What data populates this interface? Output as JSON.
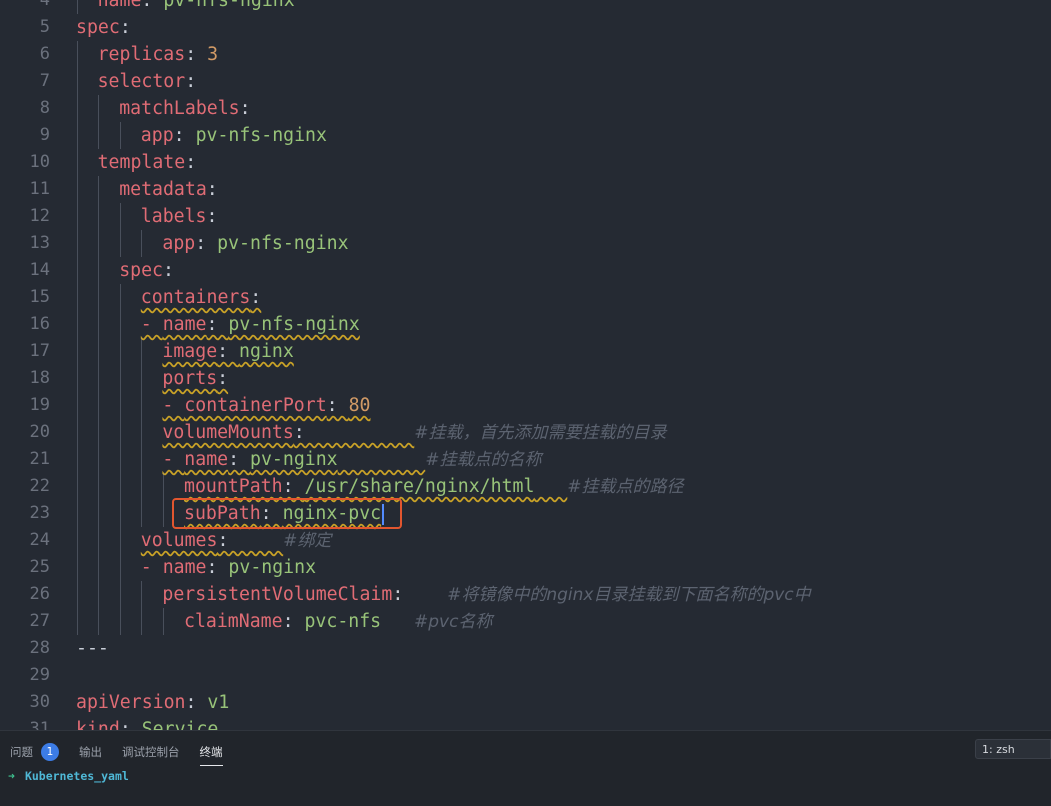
{
  "editor": {
    "lines": [
      {
        "n": "4",
        "guides": [
          1
        ],
        "tokens": [
          {
            "t": "name",
            "c": "key"
          },
          {
            "t": ": ",
            "c": "punc"
          },
          {
            "t": "pv-nfs-nginx",
            "c": "str"
          }
        ]
      },
      {
        "n": "5",
        "guides": [],
        "tokens": [
          {
            "t": "spec",
            "c": "key"
          },
          {
            "t": ":",
            "c": "punc"
          }
        ]
      },
      {
        "n": "6",
        "guides": [
          1
        ],
        "tokens": [
          {
            "t": "replicas",
            "c": "key"
          },
          {
            "t": ": ",
            "c": "punc"
          },
          {
            "t": "3",
            "c": "num"
          }
        ]
      },
      {
        "n": "7",
        "guides": [
          1
        ],
        "tokens": [
          {
            "t": "selector",
            "c": "key"
          },
          {
            "t": ":",
            "c": "punc"
          }
        ]
      },
      {
        "n": "8",
        "guides": [
          1,
          2
        ],
        "tokens": [
          {
            "t": "matchLabels",
            "c": "key"
          },
          {
            "t": ":",
            "c": "punc"
          }
        ]
      },
      {
        "n": "9",
        "guides": [
          1,
          2,
          3
        ],
        "tokens": [
          {
            "t": "app",
            "c": "key"
          },
          {
            "t": ": ",
            "c": "punc"
          },
          {
            "t": "pv-nfs-nginx",
            "c": "str"
          }
        ]
      },
      {
        "n": "10",
        "guides": [
          1
        ],
        "tokens": [
          {
            "t": "template",
            "c": "key"
          },
          {
            "t": ":",
            "c": "punc"
          }
        ]
      },
      {
        "n": "11",
        "guides": [
          1,
          2
        ],
        "tokens": [
          {
            "t": "metadata",
            "c": "key"
          },
          {
            "t": ":",
            "c": "punc"
          }
        ]
      },
      {
        "n": "12",
        "guides": [
          1,
          2,
          3
        ],
        "tokens": [
          {
            "t": "labels",
            "c": "key"
          },
          {
            "t": ":",
            "c": "punc"
          }
        ]
      },
      {
        "n": "13",
        "guides": [
          1,
          2,
          3,
          4
        ],
        "tokens": [
          {
            "t": "app",
            "c": "key"
          },
          {
            "t": ": ",
            "c": "punc"
          },
          {
            "t": "pv-nfs-nginx",
            "c": "str"
          }
        ]
      },
      {
        "n": "14",
        "guides": [
          1,
          2
        ],
        "tokens": [
          {
            "t": "spec",
            "c": "key"
          },
          {
            "t": ":",
            "c": "punc"
          }
        ]
      },
      {
        "n": "15",
        "guides": [
          1,
          2,
          3
        ],
        "wavy": true,
        "tokens": [
          {
            "t": "containers",
            "c": "key"
          },
          {
            "t": ":",
            "c": "punc"
          }
        ]
      },
      {
        "n": "16",
        "guides": [
          1,
          2,
          3
        ],
        "wavy": true,
        "tokens": [
          {
            "t": "- ",
            "c": "key"
          },
          {
            "t": "name",
            "c": "key"
          },
          {
            "t": ": ",
            "c": "punc"
          },
          {
            "t": "pv-nfs-nginx",
            "c": "str"
          }
        ]
      },
      {
        "n": "17",
        "guides": [
          1,
          2,
          3,
          4
        ],
        "wavy": true,
        "tokens": [
          {
            "t": "image",
            "c": "key"
          },
          {
            "t": ": ",
            "c": "punc"
          },
          {
            "t": "nginx",
            "c": "str"
          }
        ]
      },
      {
        "n": "18",
        "guides": [
          1,
          2,
          3,
          4
        ],
        "wavy": true,
        "tokens": [
          {
            "t": "ports",
            "c": "key"
          },
          {
            "t": ":",
            "c": "punc"
          }
        ]
      },
      {
        "n": "19",
        "guides": [
          1,
          2,
          3,
          4
        ],
        "wavy": true,
        "tokens": [
          {
            "t": "- ",
            "c": "key"
          },
          {
            "t": "containerPort",
            "c": "key"
          },
          {
            "t": ": ",
            "c": "punc"
          },
          {
            "t": "80",
            "c": "num"
          }
        ]
      },
      {
        "n": "20",
        "guides": [
          1,
          2,
          3,
          4
        ],
        "wavy": true,
        "tokens": [
          {
            "t": "volumeMounts",
            "c": "key"
          },
          {
            "t": ":          ",
            "c": "punc"
          },
          {
            "t": "#挂载，首先添加需要挂载的目录",
            "c": "cmt"
          }
        ]
      },
      {
        "n": "21",
        "guides": [
          1,
          2,
          3,
          4
        ],
        "wavy": true,
        "tokens": [
          {
            "t": "- ",
            "c": "key"
          },
          {
            "t": "name",
            "c": "key"
          },
          {
            "t": ": ",
            "c": "punc"
          },
          {
            "t": "pv-nginx",
            "c": "str"
          },
          {
            "t": "        ",
            "c": "punc"
          },
          {
            "t": "#挂载点的名称",
            "c": "cmt"
          }
        ]
      },
      {
        "n": "22",
        "guides": [
          1,
          2,
          3,
          4,
          5
        ],
        "wavy": true,
        "tokens": [
          {
            "t": "mountPath",
            "c": "key"
          },
          {
            "t": ": ",
            "c": "punc"
          },
          {
            "t": "/usr/share/nginx/html",
            "c": "str"
          },
          {
            "t": "   ",
            "c": "punc"
          },
          {
            "t": "#挂载点的路径",
            "c": "cmt"
          }
        ]
      },
      {
        "n": "23",
        "guides": [
          1,
          2,
          3,
          4,
          5
        ],
        "wavy": true,
        "cursor": true,
        "tokens": [
          {
            "t": "subPath",
            "c": "key"
          },
          {
            "t": ": ",
            "c": "punc"
          },
          {
            "t": "nginx-pvc",
            "c": "str"
          }
        ]
      },
      {
        "n": "24",
        "guides": [
          1,
          2,
          3
        ],
        "wavy": true,
        "tokens": [
          {
            "t": "volumes",
            "c": "key"
          },
          {
            "t": ":     ",
            "c": "punc"
          },
          {
            "t": "#绑定",
            "c": "cmt"
          }
        ]
      },
      {
        "n": "25",
        "guides": [
          1,
          2,
          3
        ],
        "tokens": [
          {
            "t": "- ",
            "c": "key"
          },
          {
            "t": "name",
            "c": "key"
          },
          {
            "t": ": ",
            "c": "punc"
          },
          {
            "t": "pv-nginx",
            "c": "str"
          }
        ]
      },
      {
        "n": "26",
        "guides": [
          1,
          2,
          3,
          4
        ],
        "tokens": [
          {
            "t": "persistentVolumeClaim",
            "c": "key"
          },
          {
            "t": ":    ",
            "c": "punc"
          },
          {
            "t": "#将镜像中的nginx目录挂载到下面名称的pvc中",
            "c": "cmt"
          }
        ]
      },
      {
        "n": "27",
        "guides": [
          1,
          2,
          3,
          4,
          5
        ],
        "tokens": [
          {
            "t": "claimName",
            "c": "key"
          },
          {
            "t": ": ",
            "c": "punc"
          },
          {
            "t": "pvc-nfs",
            "c": "str"
          },
          {
            "t": "   ",
            "c": "punc"
          },
          {
            "t": "#pvc名称",
            "c": "cmt"
          }
        ]
      },
      {
        "n": "28",
        "guides": [],
        "tokens": [
          {
            "t": "---",
            "c": "punc"
          }
        ]
      },
      {
        "n": "29",
        "guides": [],
        "tokens": []
      },
      {
        "n": "30",
        "guides": [],
        "tokens": [
          {
            "t": "apiVersion",
            "c": "key"
          },
          {
            "t": ": ",
            "c": "punc"
          },
          {
            "t": "v1",
            "c": "str"
          }
        ]
      },
      {
        "n": "31",
        "guides": [],
        "tokens": [
          {
            "t": "kind",
            "c": "key"
          },
          {
            "t": ": ",
            "c": "punc"
          },
          {
            "t": "Service",
            "c": "str"
          }
        ]
      }
    ]
  },
  "panel": {
    "tabs": [
      {
        "label": "问题",
        "badge": "1"
      },
      {
        "label": "输出"
      },
      {
        "label": "调试控制台"
      },
      {
        "label": "终端",
        "active": true
      }
    ],
    "terminal_select": "1: zsh",
    "prompt_arrow": "➜",
    "prompt_dir": "Kubernetes_yaml"
  }
}
